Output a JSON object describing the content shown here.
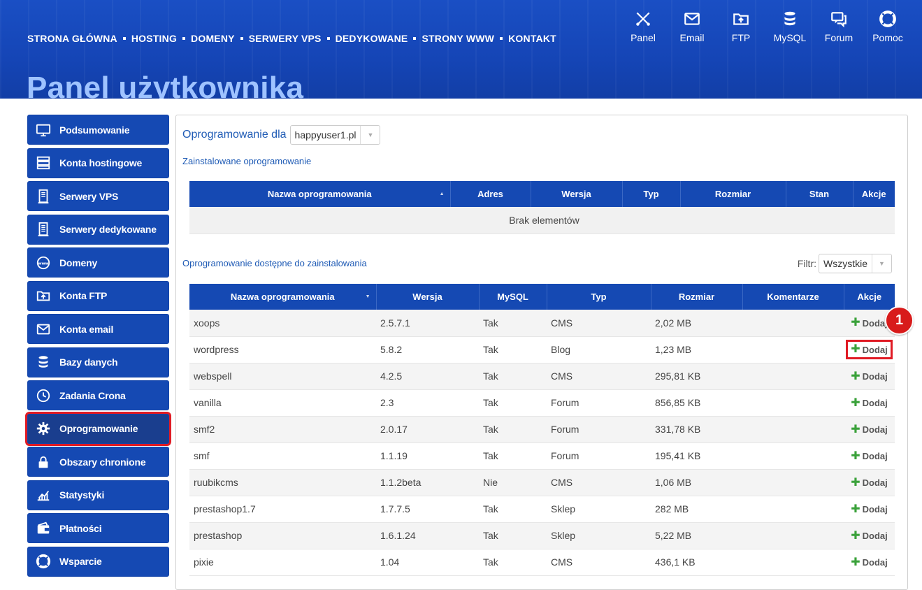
{
  "topnav": [
    "STRONA GŁÓWNA",
    "HOSTING",
    "DOMENY",
    "SERWERY VPS",
    "DEDYKOWANE",
    "STRONY WWW",
    "KONTAKT"
  ],
  "tools": [
    {
      "label": "Panel",
      "icon": "tools-icon"
    },
    {
      "label": "Email",
      "icon": "email-icon"
    },
    {
      "label": "FTP",
      "icon": "ftp-folder-icon"
    },
    {
      "label": "MySQL",
      "icon": "database-icon"
    },
    {
      "label": "Forum",
      "icon": "forum-icon"
    },
    {
      "label": "Pomoc",
      "icon": "lifebuoy-icon"
    }
  ],
  "page_title": "Panel użytkownika",
  "sidebar": {
    "items": [
      {
        "label": "Podsumowanie",
        "icon": "monitor-icon",
        "active": false
      },
      {
        "label": "Konta hostingowe",
        "icon": "server-icon",
        "active": false
      },
      {
        "label": "Serwery VPS",
        "icon": "vps-icon",
        "active": false
      },
      {
        "label": "Serwery dedykowane",
        "icon": "dedicated-server-icon",
        "active": false
      },
      {
        "label": "Domeny",
        "icon": "www-globe-icon",
        "active": false
      },
      {
        "label": "Konta FTP",
        "icon": "ftp-folder-icon",
        "active": false
      },
      {
        "label": "Konta email",
        "icon": "email-icon",
        "active": false
      },
      {
        "label": "Bazy danych",
        "icon": "database-icon",
        "active": false
      },
      {
        "label": "Zadania Crona",
        "icon": "clock-icon",
        "active": false
      },
      {
        "label": "Oprogramowanie",
        "icon": "gear-icon",
        "active": true
      },
      {
        "label": "Obszary chronione",
        "icon": "lock-icon",
        "active": false
      },
      {
        "label": "Statystyki",
        "icon": "chart-icon",
        "active": false
      },
      {
        "label": "Płatności",
        "icon": "wallet-icon",
        "active": false
      },
      {
        "label": "Wsparcie",
        "icon": "lifebuoy-icon",
        "active": false
      }
    ]
  },
  "software": {
    "title": "Oprogramowanie dla",
    "account_select": "happyuser1.pl",
    "installed_heading": "Zainstalowane oprogramowanie",
    "installed_columns": [
      "Nazwa oprogramowania",
      "Adres",
      "Wersja",
      "Typ",
      "Rozmiar",
      "Stan",
      "Akcje"
    ],
    "installed_empty": "Brak elementów",
    "available_heading": "Oprogramowanie dostępne do zainstalowania",
    "filter_label": "Filtr:",
    "filter_value": "Wszystkie",
    "available_columns": [
      "Nazwa oprogramowania",
      "Wersja",
      "MySQL",
      "Typ",
      "Rozmiar",
      "Komentarze",
      "Akcje"
    ],
    "action_label": "Dodaj",
    "rows": [
      {
        "name": "xoops",
        "version": "2.5.7.1",
        "mysql": "Tak",
        "type": "CMS",
        "size": "2,02 MB",
        "comments": ""
      },
      {
        "name": "wordpress",
        "version": "5.8.2",
        "mysql": "Tak",
        "type": "Blog",
        "size": "1,23 MB",
        "comments": ""
      },
      {
        "name": "webspell",
        "version": "4.2.5",
        "mysql": "Tak",
        "type": "CMS",
        "size": "295,81 KB",
        "comments": ""
      },
      {
        "name": "vanilla",
        "version": "2.3",
        "mysql": "Tak",
        "type": "Forum",
        "size": "856,85 KB",
        "comments": ""
      },
      {
        "name": "smf2",
        "version": "2.0.17",
        "mysql": "Tak",
        "type": "Forum",
        "size": "331,78 KB",
        "comments": ""
      },
      {
        "name": "smf",
        "version": "1.1.19",
        "mysql": "Tak",
        "type": "Forum",
        "size": "195,41 KB",
        "comments": ""
      },
      {
        "name": "ruubikcms",
        "version": "1.1.2beta",
        "mysql": "Nie",
        "type": "CMS",
        "size": "1,06 MB",
        "comments": ""
      },
      {
        "name": "prestashop1.7",
        "version": "1.7.7.5",
        "mysql": "Tak",
        "type": "Sklep",
        "size": "282 MB",
        "comments": ""
      },
      {
        "name": "prestashop",
        "version": "1.6.1.24",
        "mysql": "Tak",
        "type": "Sklep",
        "size": "5,22 MB",
        "comments": ""
      },
      {
        "name": "pixie",
        "version": "1.04",
        "mysql": "Tak",
        "type": "CMS",
        "size": "436,1 KB",
        "comments": ""
      }
    ],
    "highlighted_row_index": 1
  },
  "annotation_badge": "1",
  "colors": {
    "primary": "#1549b3",
    "highlight": "#e01b24",
    "add_green": "#3aa13a",
    "link_blue": "#1f5bb5"
  }
}
